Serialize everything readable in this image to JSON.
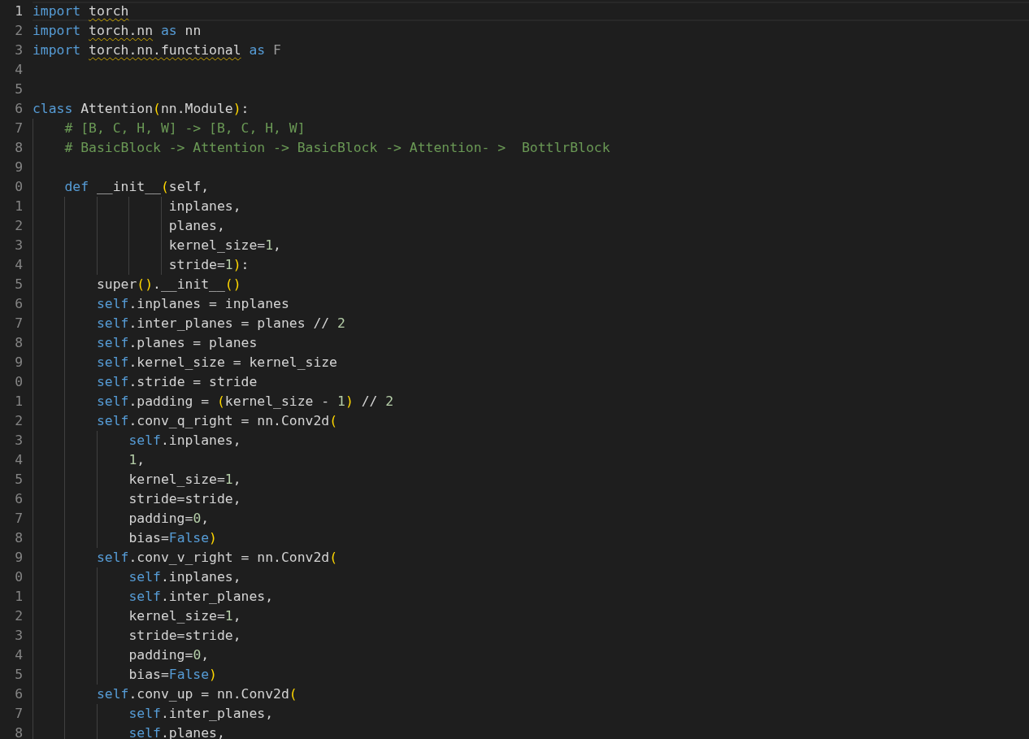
{
  "editor": {
    "lines": [
      {
        "number": "1",
        "current": true,
        "tokens": [
          {
            "text": "import ",
            "kind": "keyword"
          },
          {
            "text": "torch",
            "kind": "module"
          }
        ]
      },
      {
        "number": "2",
        "current": false,
        "tokens": [
          {
            "text": "import ",
            "kind": "keyword"
          },
          {
            "text": "torch.nn",
            "kind": "module"
          },
          {
            "text": " as",
            "kind": "keyword"
          },
          {
            "text": " nn",
            "kind": "plain"
          }
        ]
      },
      {
        "number": "3",
        "current": false,
        "tokens": [
          {
            "text": "import ",
            "kind": "keyword"
          },
          {
            "text": "torch.nn.functional",
            "kind": "module"
          },
          {
            "text": " as ",
            "kind": "keyword"
          },
          {
            "text": "F",
            "kind": "dim"
          }
        ]
      },
      {
        "number": "4",
        "current": false
      },
      {
        "number": "5",
        "current": false
      },
      {
        "number": "6",
        "current": false,
        "tokens": [
          {
            "text": "class",
            "kind": "keyword"
          },
          {
            "text": " Attention",
            "kind": "plain"
          },
          {
            "text": "(",
            "kind": "bracket"
          },
          {
            "text": "nn.Module",
            "kind": "plain"
          },
          {
            "text": ")",
            "kind": "bracket"
          },
          {
            "text": ":",
            "kind": "plain"
          }
        ]
      },
      {
        "number": "7",
        "current": false,
        "tokens": [
          {
            "text": "    # [B, C, H, W] -> [B, C, H, W]",
            "kind": "comment"
          }
        ]
      },
      {
        "number": "8",
        "current": false,
        "tokens": [
          {
            "text": "    # BasicBlock -> Attention -> BasicBlock -> Attention- >  BottlrBlock",
            "kind": "comment"
          }
        ]
      },
      {
        "number": "9",
        "current": false
      },
      {
        "number": "0",
        "current": false,
        "tokens": [
          {
            "text": "    def",
            "kind": "keyword"
          },
          {
            "text": " __init__",
            "kind": "plain"
          },
          {
            "text": "(",
            "kind": "bracket"
          },
          {
            "text": "self,",
            "kind": "plain"
          }
        ]
      },
      {
        "number": "1",
        "current": false,
        "tokens": [
          {
            "text": "                 inplanes,",
            "kind": "plain"
          }
        ]
      },
      {
        "number": "2",
        "current": false,
        "tokens": [
          {
            "text": "                 planes,",
            "kind": "plain"
          }
        ]
      },
      {
        "number": "3",
        "current": false,
        "tokens": [
          {
            "text": "                 kernel_size=",
            "kind": "plain"
          },
          {
            "text": "1",
            "kind": "number"
          },
          {
            "text": ",",
            "kind": "plain"
          }
        ]
      },
      {
        "number": "4",
        "current": false,
        "tokens": [
          {
            "text": "                 stride=",
            "kind": "plain"
          },
          {
            "text": "1",
            "kind": "number"
          },
          {
            "text": ")",
            "kind": "bracket"
          },
          {
            "text": ":",
            "kind": "plain"
          }
        ]
      },
      {
        "number": "5",
        "current": false,
        "tokens": [
          {
            "text": "        super",
            "kind": "plain"
          },
          {
            "text": "()",
            "kind": "bracket"
          },
          {
            "text": ".__init__",
            "kind": "plain"
          },
          {
            "text": "()",
            "kind": "bracket"
          }
        ]
      },
      {
        "number": "6",
        "current": false,
        "tokens": [
          {
            "text": "        self",
            "kind": "keyword"
          },
          {
            "text": ".inplanes = inplanes",
            "kind": "plain"
          }
        ]
      },
      {
        "number": "7",
        "current": false,
        "tokens": [
          {
            "text": "        self",
            "kind": "keyword"
          },
          {
            "text": ".inter_planes = planes // ",
            "kind": "plain"
          },
          {
            "text": "2",
            "kind": "number"
          }
        ]
      },
      {
        "number": "8",
        "current": false,
        "tokens": [
          {
            "text": "        self",
            "kind": "keyword"
          },
          {
            "text": ".planes = planes",
            "kind": "plain"
          }
        ]
      },
      {
        "number": "9",
        "current": false,
        "tokens": [
          {
            "text": "        self",
            "kind": "keyword"
          },
          {
            "text": ".kernel_size = kernel_size",
            "kind": "plain"
          }
        ]
      },
      {
        "number": "0",
        "current": false,
        "tokens": [
          {
            "text": "        self",
            "kind": "keyword"
          },
          {
            "text": ".stride = stride",
            "kind": "plain"
          }
        ]
      },
      {
        "number": "1",
        "current": false,
        "tokens": [
          {
            "text": "        self",
            "kind": "keyword"
          },
          {
            "text": ".padding = ",
            "kind": "plain"
          },
          {
            "text": "(",
            "kind": "bracket"
          },
          {
            "text": "kernel_size - ",
            "kind": "plain"
          },
          {
            "text": "1",
            "kind": "number"
          },
          {
            "text": ")",
            "kind": "bracket"
          },
          {
            "text": " // ",
            "kind": "plain"
          },
          {
            "text": "2",
            "kind": "number"
          }
        ]
      },
      {
        "number": "2",
        "current": false,
        "tokens": [
          {
            "text": "        self",
            "kind": "keyword"
          },
          {
            "text": ".conv_q_right = nn.Conv2d",
            "kind": "plain"
          },
          {
            "text": "(",
            "kind": "bracket"
          }
        ]
      },
      {
        "number": "3",
        "current": false,
        "tokens": [
          {
            "text": "            self",
            "kind": "keyword"
          },
          {
            "text": ".inplanes,",
            "kind": "plain"
          }
        ]
      },
      {
        "number": "4",
        "current": false,
        "tokens": [
          {
            "text": "            1",
            "kind": "number"
          },
          {
            "text": ",",
            "kind": "plain"
          }
        ]
      },
      {
        "number": "5",
        "current": false,
        "tokens": [
          {
            "text": "            kernel_size=",
            "kind": "plain"
          },
          {
            "text": "1",
            "kind": "number"
          },
          {
            "text": ",",
            "kind": "plain"
          }
        ]
      },
      {
        "number": "6",
        "current": false,
        "tokens": [
          {
            "text": "            stride=stride,",
            "kind": "plain"
          }
        ]
      },
      {
        "number": "7",
        "current": false,
        "tokens": [
          {
            "text": "            padding=",
            "kind": "plain"
          },
          {
            "text": "0",
            "kind": "number"
          },
          {
            "text": ",",
            "kind": "plain"
          }
        ]
      },
      {
        "number": "8",
        "current": false,
        "tokens": [
          {
            "text": "            bias=",
            "kind": "plain"
          },
          {
            "text": "False",
            "kind": "keyword"
          },
          {
            "text": ")",
            "kind": "bracket"
          }
        ]
      },
      {
        "number": "9",
        "current": false,
        "tokens": [
          {
            "text": "        self",
            "kind": "keyword"
          },
          {
            "text": ".conv_v_right = nn.Conv2d",
            "kind": "plain"
          },
          {
            "text": "(",
            "kind": "bracket"
          }
        ]
      },
      {
        "number": "0",
        "current": false,
        "tokens": [
          {
            "text": "            self",
            "kind": "keyword"
          },
          {
            "text": ".inplanes,",
            "kind": "plain"
          }
        ]
      },
      {
        "number": "1",
        "current": false,
        "tokens": [
          {
            "text": "            self",
            "kind": "keyword"
          },
          {
            "text": ".inter_planes,",
            "kind": "plain"
          }
        ]
      },
      {
        "number": "2",
        "current": false,
        "tokens": [
          {
            "text": "            kernel_size=",
            "kind": "plain"
          },
          {
            "text": "1",
            "kind": "number"
          },
          {
            "text": ",",
            "kind": "plain"
          }
        ]
      },
      {
        "number": "3",
        "current": false,
        "tokens": [
          {
            "text": "            stride=stride,",
            "kind": "plain"
          }
        ]
      },
      {
        "number": "4",
        "current": false,
        "tokens": [
          {
            "text": "            padding=",
            "kind": "plain"
          },
          {
            "text": "0",
            "kind": "number"
          },
          {
            "text": ",",
            "kind": "plain"
          }
        ]
      },
      {
        "number": "5",
        "current": false,
        "tokens": [
          {
            "text": "            bias=",
            "kind": "plain"
          },
          {
            "text": "False",
            "kind": "keyword"
          },
          {
            "text": ")",
            "kind": "bracket"
          }
        ]
      },
      {
        "number": "6",
        "current": false,
        "tokens": [
          {
            "text": "        self",
            "kind": "keyword"
          },
          {
            "text": ".conv_up = nn.Conv2d",
            "kind": "plain"
          },
          {
            "text": "(",
            "kind": "bracket"
          }
        ]
      },
      {
        "number": "7",
        "current": false,
        "tokens": [
          {
            "text": "            self",
            "kind": "keyword"
          },
          {
            "text": ".inter_planes,",
            "kind": "plain"
          }
        ]
      },
      {
        "number": "8",
        "current": false,
        "tokens": [
          {
            "text": "            self",
            "kind": "keyword"
          },
          {
            "text": ".planes,",
            "kind": "plain"
          }
        ]
      }
    ]
  }
}
